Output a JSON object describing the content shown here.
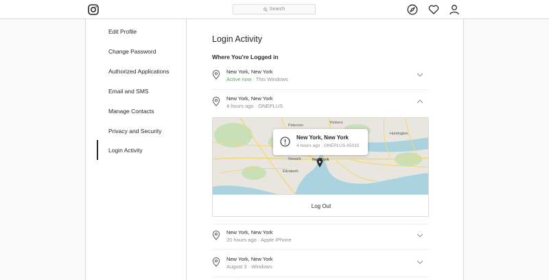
{
  "header": {
    "logo_icon": "instagram-icon",
    "search_placeholder": "Search",
    "icons": [
      "compass-icon",
      "heart-icon",
      "person-icon"
    ]
  },
  "sidebar": {
    "items": [
      {
        "label": "Edit Profile"
      },
      {
        "label": "Change Password"
      },
      {
        "label": "Authorized Applications"
      },
      {
        "label": "Email and SMS"
      },
      {
        "label": "Manage Contacts"
      },
      {
        "label": "Privacy and Security"
      },
      {
        "label": "Login Activity",
        "active": true
      }
    ]
  },
  "main": {
    "title": "Login Activity",
    "section_title": "Where You're Logged in",
    "sessions": [
      {
        "location": "New York, New York",
        "status": "Active now",
        "device": " · This Windows",
        "expanded": false
      },
      {
        "location": "New York, New York",
        "status": "",
        "device": "4 hours ago · ONEPLUS",
        "expanded": true
      },
      {
        "location": "New York, New York",
        "status": "",
        "device": "20 hours ago · Apple iPhone",
        "expanded": false
      },
      {
        "location": "New York, New York",
        "status": "",
        "device": "August 3 · Windows",
        "expanded": false
      }
    ],
    "map": {
      "tooltip_title": "New York, New York",
      "tooltip_meta": "4 hours ago · ONEPLUS A5010",
      "labels": [
        "Paterson",
        "Yonkers",
        "Huntington",
        "Newark",
        "Elizabeth",
        "New York"
      ],
      "logout_label": "Log Out"
    }
  },
  "colors": {
    "active_green": "#3dbb3d",
    "border": "#dbdbdb",
    "muted": "#8e8e8e",
    "text": "#262626"
  }
}
